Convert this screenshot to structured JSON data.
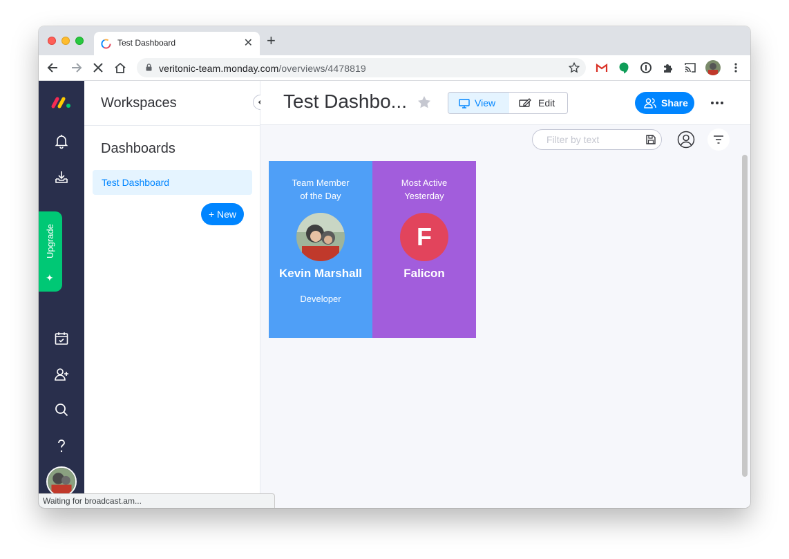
{
  "browser": {
    "tab_title": "Test Dashboard",
    "url_host": "veritonic-team.monday.com",
    "url_path": "/overviews/4478819",
    "status": "Waiting for broadcast.am..."
  },
  "sidebar": {
    "upgrade_label": "Upgrade"
  },
  "workspace": {
    "title": "Workspaces",
    "dashboards_heading": "Dashboards",
    "items": [
      {
        "label": "Test Dashboard"
      }
    ],
    "new_button": "+ New"
  },
  "header": {
    "title": "Test Dashbo...",
    "view_label": "View",
    "edit_label": "Edit",
    "share_label": "Share"
  },
  "filter": {
    "placeholder": "Filter by text"
  },
  "widgets": [
    {
      "title_line1": "Team Member",
      "title_line2": "of the Day",
      "name": "Kevin Marshall",
      "role": "Developer",
      "color": "#4f9ff7"
    },
    {
      "title_line1": "Most Active",
      "title_line2": "Yesterday",
      "name": "Falicon",
      "initial": "F",
      "color": "#a25ddc",
      "avatar_color": "#e2445c"
    }
  ],
  "colors": {
    "accent": "#0085ff",
    "nav_bg": "#292f4c",
    "upgrade": "#00c875"
  }
}
